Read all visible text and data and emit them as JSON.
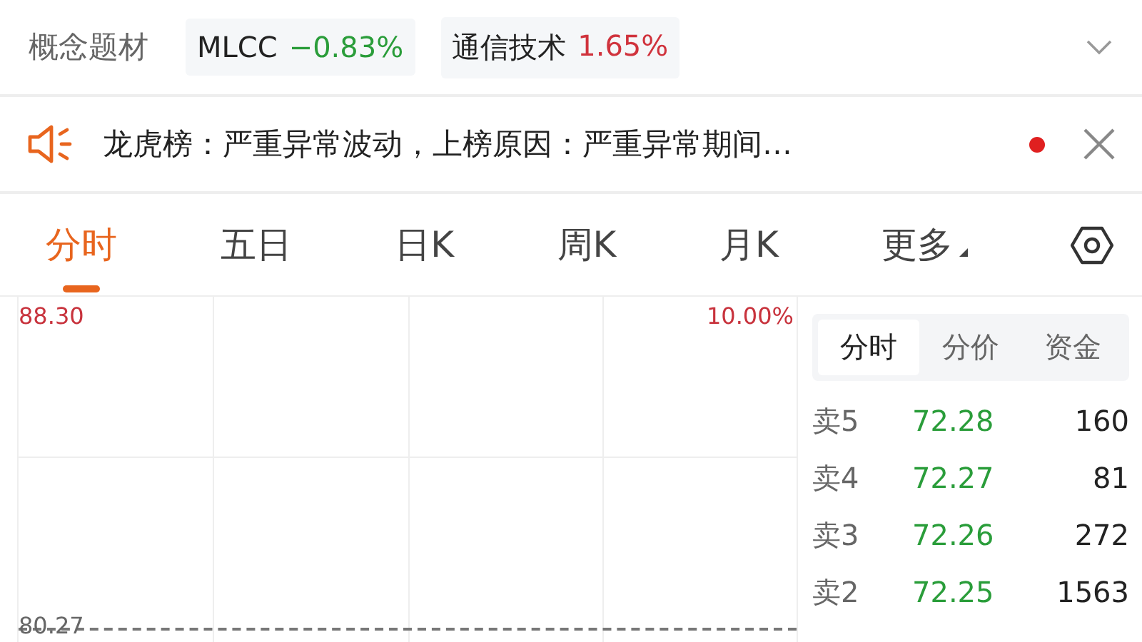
{
  "concepts": {
    "label": "概念题材",
    "tags": [
      {
        "name": "MLCC",
        "change": "−0.83%",
        "color": "#2a9d3a"
      },
      {
        "name": "通信技术",
        "change": "1.65%",
        "color": "#d0333d"
      }
    ]
  },
  "notice": {
    "text": "龙虎榜：严重异常波动，上榜原因：严重异常期间…",
    "unread": true
  },
  "period_tabs": [
    {
      "label": "分时",
      "selected": true
    },
    {
      "label": "五日",
      "selected": false
    },
    {
      "label": "日K",
      "selected": false
    },
    {
      "label": "周K",
      "selected": false
    },
    {
      "label": "月K",
      "selected": false
    },
    {
      "label": "更多",
      "selected": false,
      "kind": "menu"
    }
  ],
  "chart": {
    "top_price": "88.30",
    "top_percent": "10.00%",
    "base_price": "80.27"
  },
  "side_tabs": [
    {
      "label": "分时",
      "selected": true
    },
    {
      "label": "分价",
      "selected": false
    },
    {
      "label": "资金",
      "selected": false
    }
  ],
  "order_book": [
    {
      "label": "卖5",
      "price": "72.28",
      "volume": "160"
    },
    {
      "label": "卖4",
      "price": "72.27",
      "volume": "81"
    },
    {
      "label": "卖3",
      "price": "72.26",
      "volume": "272"
    },
    {
      "label": "卖2",
      "price": "72.25",
      "volume": "1563"
    }
  ]
}
